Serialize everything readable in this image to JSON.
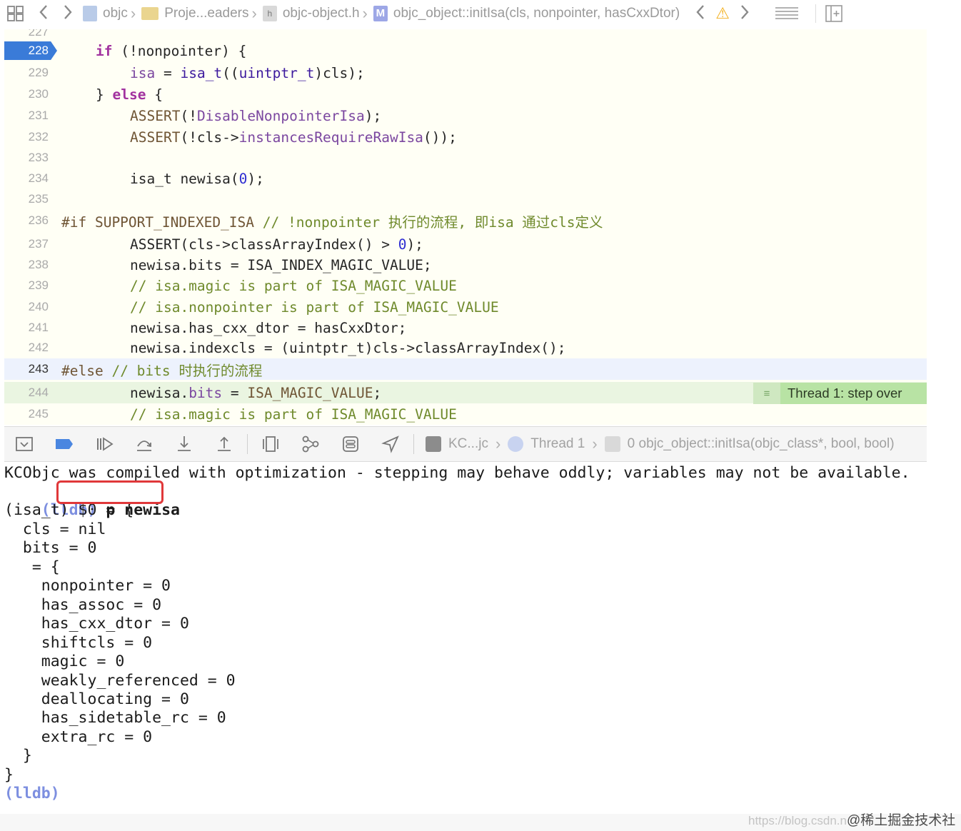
{
  "jumpbar": {
    "crumbs": [
      "objc",
      "Proje...eaders",
      "objc-object.h",
      "objc_object::initIsa(cls, nonpointer, hasCxxDtor)"
    ],
    "warning_glyph": "⚠",
    "back_glyph": "〈",
    "forward_glyph": "〉"
  },
  "editor": {
    "lines": [
      {
        "no": "227",
        "code": ""
      },
      {
        "no": "228",
        "code": "if (!nonpointer) {"
      },
      {
        "no": "229",
        "code": "isa = isa_t((uintptr_t)cls);"
      },
      {
        "no": "230",
        "code": "} else {"
      },
      {
        "no": "231",
        "code": "ASSERT(!DisableNonpointerIsa);"
      },
      {
        "no": "232",
        "code": "ASSERT(!cls->instancesRequireRawIsa());"
      },
      {
        "no": "233",
        "code": ""
      },
      {
        "no": "234",
        "code": "isa_t newisa(0);"
      },
      {
        "no": "235",
        "code": ""
      },
      {
        "no": "236",
        "code": "#if SUPPORT_INDEXED_ISA // !nonpointer 执行的流程, 即isa 通过cls定义"
      },
      {
        "no": "237",
        "code": "ASSERT(cls->classArrayIndex() > 0);"
      },
      {
        "no": "238",
        "code": "newisa.bits = ISA_INDEX_MAGIC_VALUE;"
      },
      {
        "no": "239",
        "code": "// isa.magic is part of ISA_MAGIC_VALUE"
      },
      {
        "no": "240",
        "code": "// isa.nonpointer is part of ISA_MAGIC_VALUE"
      },
      {
        "no": "241",
        "code": "newisa.has_cxx_dtor = hasCxxDtor;"
      },
      {
        "no": "242",
        "code": "newisa.indexcls = (uintptr_t)cls->classArrayIndex();"
      },
      {
        "no": "243",
        "code": "#else // bits 时执行的流程"
      },
      {
        "no": "244",
        "code": "newisa.bits = ISA_MAGIC_VALUE;"
      },
      {
        "no": "245",
        "code": "// isa.magic is part of ISA_MAGIC_VALUE"
      }
    ],
    "breakpoint_line": "228",
    "thread_badge": "Thread 1: step over"
  },
  "debugbar": {
    "target": "KC...jc",
    "thread": "Thread 1",
    "frame": "0 objc_object::initIsa(objc_class*, bool, bool)"
  },
  "console": {
    "warning": "KCObjc was compiled with optimization - stepping may behave oddly; variables may not be available.",
    "prompt": "(lldb)",
    "command": "p newisa",
    "output": [
      "(isa_t) $0 = {",
      "  cls = nil",
      "  bits = 0",
      "   = {",
      "    nonpointer = 0",
      "    has_assoc = 0",
      "    has_cxx_dtor = 0",
      "    shiftcls = 0",
      "    magic = 0",
      "    weakly_referenced = 0",
      "    deallocating = 0",
      "    has_sidetable_rc = 0",
      "    extra_rc = 0",
      "  }",
      "}"
    ],
    "final_prompt": "(lldb)"
  },
  "watermark": {
    "url": "https://blog.csdn.n",
    "brand": "@稀土掘金技术社区"
  }
}
